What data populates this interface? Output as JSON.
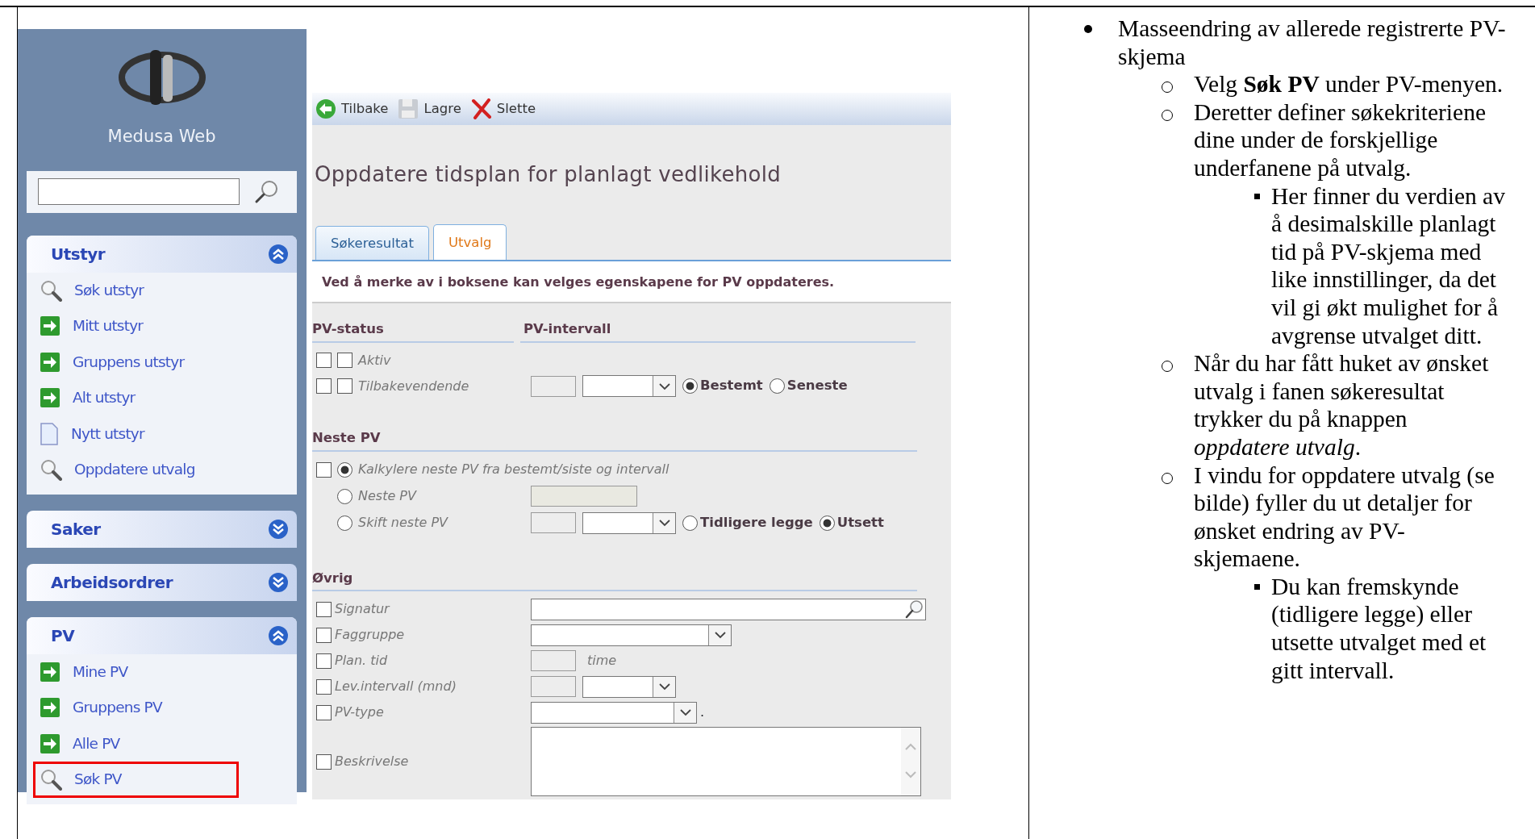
{
  "sidebar": {
    "app_title": "Medusa Web",
    "sections": [
      {
        "title": "Utstyr",
        "expanded": true,
        "items": [
          {
            "label": "Søk utstyr",
            "kind": "search",
            "highlighted": false
          },
          {
            "label": "Mitt utstyr",
            "kind": "arrow",
            "highlighted": false
          },
          {
            "label": "Gruppens utstyr",
            "kind": "arrow",
            "highlighted": false
          },
          {
            "label": "Alt utstyr",
            "kind": "arrow",
            "highlighted": false
          },
          {
            "label": "Nytt utstyr",
            "kind": "page",
            "highlighted": false
          },
          {
            "label": "Oppdatere utvalg",
            "kind": "search",
            "highlighted": false
          }
        ]
      },
      {
        "title": "Saker",
        "expanded": false
      },
      {
        "title": "Arbeidsordrer",
        "expanded": false
      },
      {
        "title": "PV",
        "expanded": true,
        "items": [
          {
            "label": "Mine PV",
            "kind": "arrow",
            "highlighted": false
          },
          {
            "label": "Gruppens PV",
            "kind": "arrow",
            "highlighted": false
          },
          {
            "label": "Alle PV",
            "kind": "arrow",
            "highlighted": false
          },
          {
            "label": "Søk PV",
            "kind": "search",
            "highlighted": true
          }
        ]
      }
    ]
  },
  "toolbar": [
    {
      "label": "Tilbake",
      "kind": "back"
    },
    {
      "label": "Lagre",
      "kind": "save"
    },
    {
      "label": "Slette",
      "kind": "delete"
    }
  ],
  "heading": "Oppdatere tidsplan for planlagt vedlikehold",
  "tabs": [
    {
      "label": "Søkeresultat",
      "selected": false
    },
    {
      "label": "Utvalg",
      "selected": true
    }
  ],
  "info": "Ved å merke av i boksene kan velges egenskapene for PV oppdateres.",
  "pv_status": {
    "title": "PV-status",
    "rows": [
      {
        "label": "Aktiv",
        "checked": false,
        "value_checked": false
      },
      {
        "label": "Tilbakevendende",
        "checked": false,
        "value_checked": false
      }
    ]
  },
  "pv_interval": {
    "title": "PV-intervall",
    "radios": [
      {
        "label": "Bestemt",
        "selected": true
      },
      {
        "label": "Seneste",
        "selected": false
      }
    ]
  },
  "next_pv": {
    "title": "Neste PV",
    "checked": false,
    "options": [
      {
        "label": "Kalkylere neste PV fra bestemt/siste og intervall",
        "kind": "plain",
        "selected": true
      },
      {
        "label": "Neste PV",
        "kind": "date",
        "selected": false
      },
      {
        "label": "Skift neste PV",
        "kind": "shift",
        "selected": false
      }
    ],
    "shift_radios": [
      {
        "label": "Tidligere legge",
        "selected": false
      },
      {
        "label": "Utsett",
        "selected": true
      }
    ]
  },
  "other": {
    "title": "Øvrig",
    "rows": [
      {
        "label": "Signatur",
        "kind": "lookup",
        "checked": false
      },
      {
        "label": "Faggruppe",
        "kind": "select",
        "checked": false
      },
      {
        "label": "Plan. tid",
        "kind": "number",
        "checked": false,
        "unit": "time"
      },
      {
        "label": "Lev.intervall (mnd)",
        "kind": "number-select",
        "checked": false
      },
      {
        "label": "PV-type",
        "kind": "select-suffix",
        "checked": false,
        "suffix": "."
      },
      {
        "label": "Beskrivelse",
        "kind": "textarea",
        "checked": false
      }
    ]
  },
  "notes": [
    {
      "text": "Masseendring av allerede registrerte PV-skjema",
      "children": [
        {
          "text": "Velg **Søk PV** under PV-menyen."
        },
        {
          "text": "Deretter definer søkekriteriene dine under de forskjellige underfanene på utvalg.",
          "children": [
            {
              "text": "Her finner du verdien av å desimalskille planlagt tid på PV-skjema med like innstillinger, da det vil gi økt mulighet for å avgrense utvalget ditt."
            }
          ]
        },
        {
          "text": "Når du har fått huket av ønsket utvalg i fanen søkeresultat trykker du på knappen *oppdatere utvalg*."
        },
        {
          "text": "I vindu for oppdatere utvalg (se bilde) fyller du ut detaljer for ønsket endring av PV-skjemaene.",
          "children": [
            {
              "text": "Du kan fremskynde (tidligere legge) eller utsette utvalget med et gitt intervall."
            }
          ]
        }
      ]
    }
  ]
}
